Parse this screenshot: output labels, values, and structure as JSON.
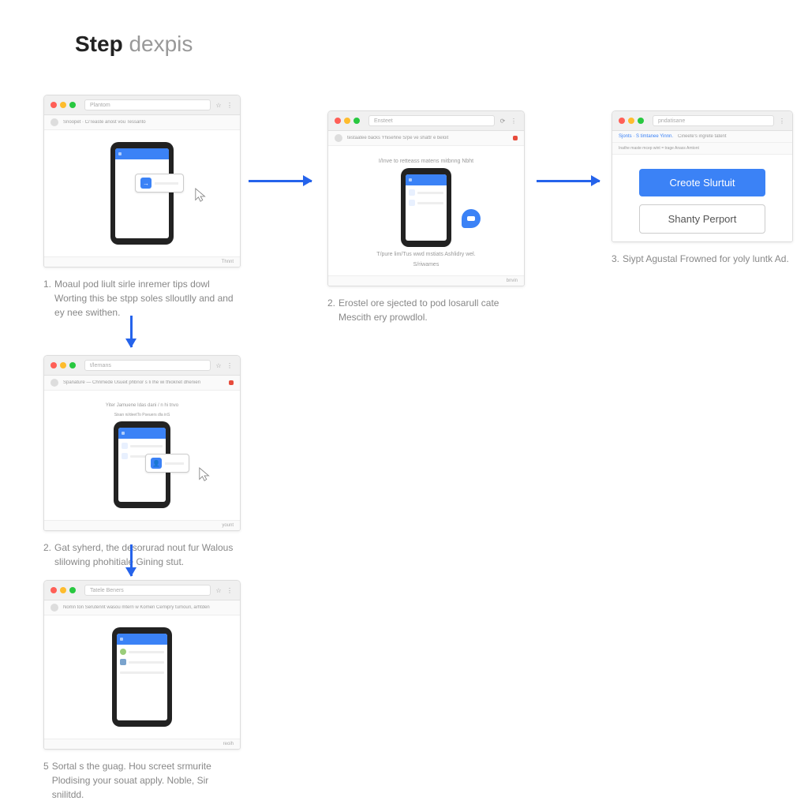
{
  "title": {
    "bold": "Step",
    "light": "dexpis"
  },
  "steps": [
    {
      "num": "1.",
      "caption": "Moaul pod liult sirle inremer tips dowl Worting this be stpp soles slloutlly and and ey nee swithen.",
      "url": "Plantom",
      "toolbar": "Snoopet · C/Teaste anost vou Tessanto",
      "footer": "Thnnt "
    },
    {
      "num": "2.",
      "caption": "Erostel ore sjected to pod losarull cate Mescith ery prowdlol.",
      "url": "Ensteet",
      "toolbar": "testaatee backs Yhisehne S/pe ve shattr e beloit",
      "red_text": "I/Inve to retteass matens mitbnng Nbht",
      "desc": "T/pure lim/Tus wwd mstiats Ashlidry wel.",
      "green": "S/riwames",
      "footer": "bnvin "
    },
    {
      "num": "3.",
      "caption": "Siypt Agustal Frowned for yoly luntk Ad.",
      "url": "pndatisane",
      "toolbar_a": "Sjonts · S timtanee Yinnn. ",
      "toolbar_b": "Cineete's irigrete tatent",
      "sub": "Inathe maste mcep wint = trage Anass Amtont",
      "primary_btn": "Creote Slurtuit",
      "secondary_btn": "Shanty Perport"
    },
    {
      "num": "2.",
      "caption": "Gat syherd, the desorurad nout fur Walous slilowing phohitiale Gining stut.",
      "url": "t/lernans",
      "toolbar": "Spanature — Chnmede Usueit phbnor s Ii lhe wi thioknet dhenien",
      "header_a": "Yiter Jamuene Idas dani / n hi tnvo",
      "header_b": "Sisan ni/deetTo Pseuers dla inS",
      "footer": "yount "
    },
    {
      "num": "5",
      "caption": "Sortal s the guag. Hou screet srmurite Plodising your souat apply. Noble, Sir snilitdd.",
      "url": "Tatele Beners",
      "toolbar": "Nomn ton Serutennt wasou mtern w Komen Cemipry tumouri, arhtden",
      "footer": "reoih "
    }
  ]
}
